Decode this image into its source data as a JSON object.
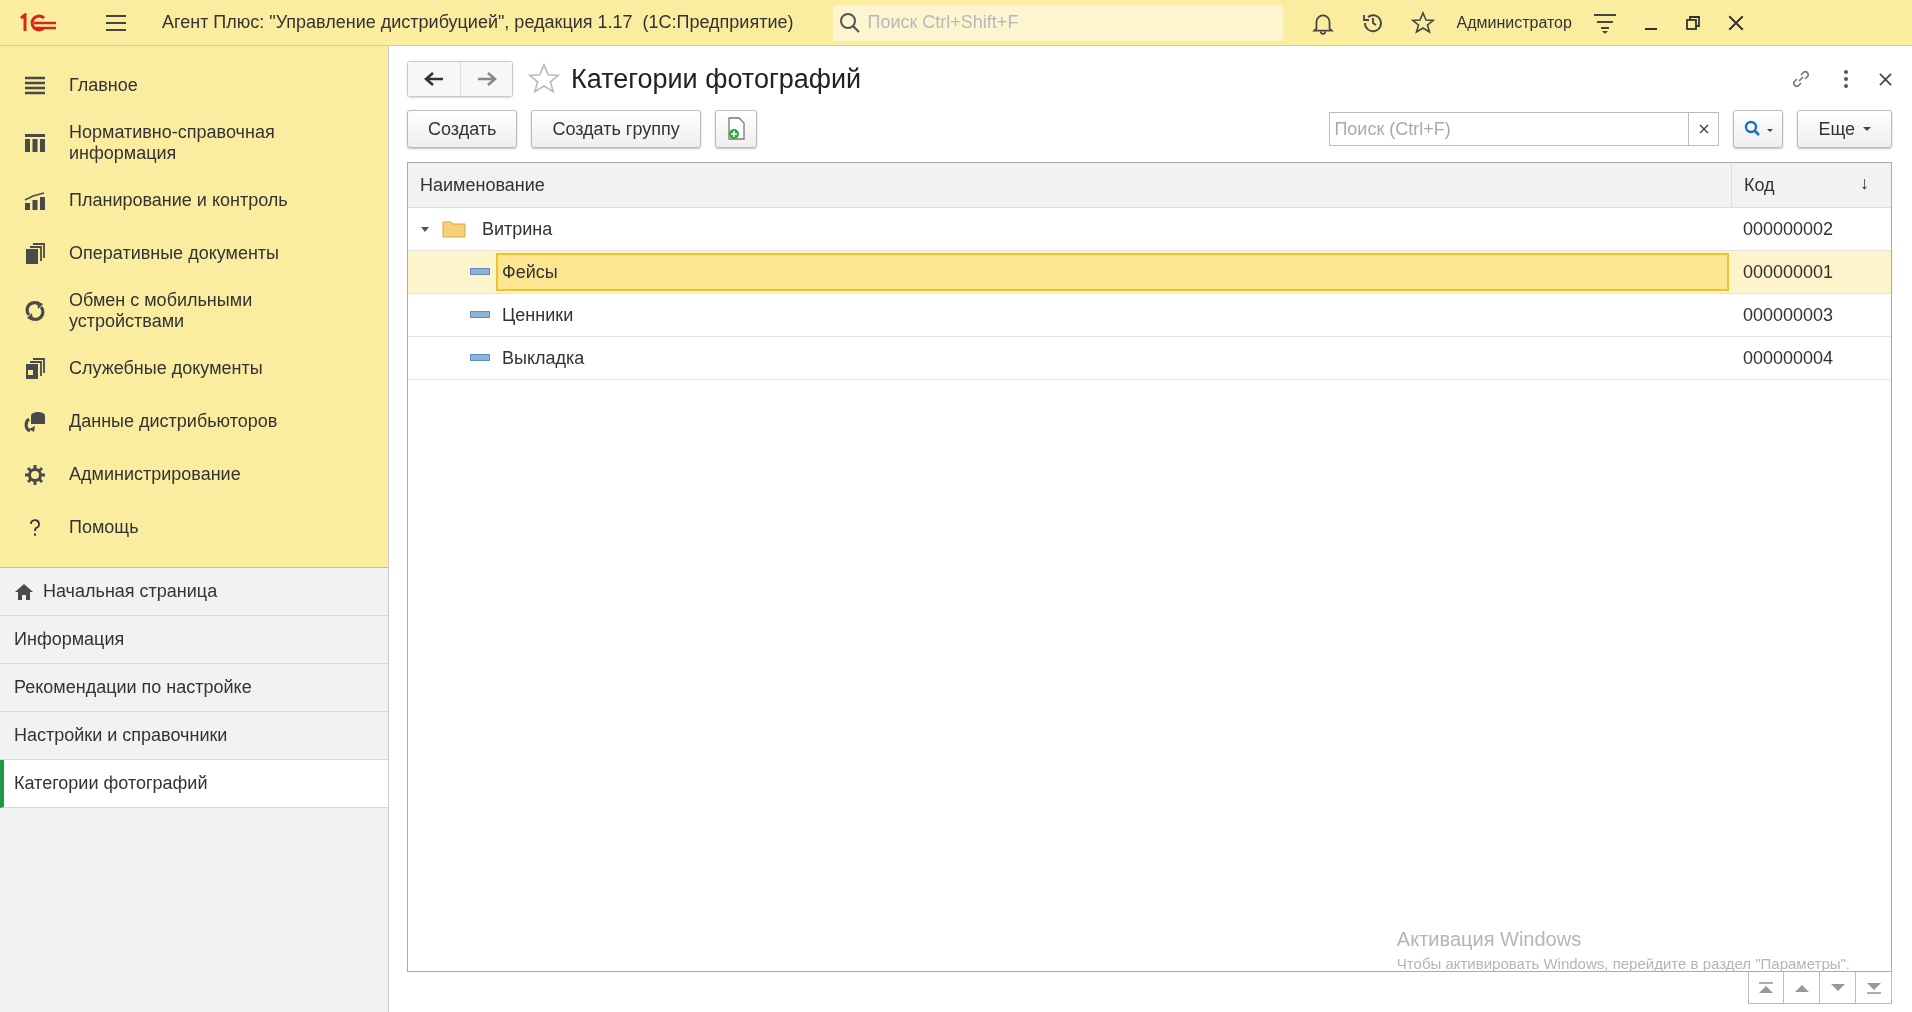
{
  "app_bar": {
    "title": "Агент Плюс: \"Управление дистрибуцией\", редакция 1.17  (1С:Предприятие)",
    "search": {
      "placeholder": "Поиск Ctrl+Shift+F"
    },
    "user": "Администратор"
  },
  "sections": [
    {
      "label": "Главное"
    },
    {
      "label": "Нормативно-справочная информация"
    },
    {
      "label": "Планирование и контроль"
    },
    {
      "label": "Оперативные документы"
    },
    {
      "label": "Обмен с мобильными устройствами"
    },
    {
      "label": "Служебные документы"
    },
    {
      "label": "Данные дистрибьюторов"
    },
    {
      "label": "Администрирование"
    },
    {
      "label": "Помощь"
    }
  ],
  "open_windows": [
    {
      "label": "Начальная страница",
      "selected": false
    },
    {
      "label": "Информация",
      "selected": false
    },
    {
      "label": "Рекомендации по настройке",
      "selected": false
    },
    {
      "label": "Настройки и справочники",
      "selected": false
    },
    {
      "label": "Категории фотографий",
      "selected": true
    }
  ],
  "form": {
    "title": "Категории фотографий",
    "favorite": false,
    "buttons": [
      "Создать",
      "Создать группу"
    ],
    "search": {
      "placeholder": "Поиск (Ctrl+F)"
    },
    "more": "Еще",
    "table": {
      "columns": [
        "Наименование",
        "Код"
      ],
      "sort_mark": "↓",
      "rows": [
        {
          "kind": "group",
          "name": "Витрина",
          "code": "000000002",
          "expanded": true,
          "selected": false,
          "children": [
            {
              "kind": "item",
              "name": "Фейсы",
              "code": "000000001",
              "selected": true
            },
            {
              "kind": "item",
              "name": "Ценники",
              "code": "000000003",
              "selected": false
            },
            {
              "kind": "item",
              "name": "Выкладка",
              "code": "000000004",
              "selected": false
            }
          ]
        }
      ]
    }
  },
  "os_notice": {
    "title": "Активация Windows",
    "text": "Чтобы активировать Windows, перейдите в раздел \"Параметры\"."
  }
}
